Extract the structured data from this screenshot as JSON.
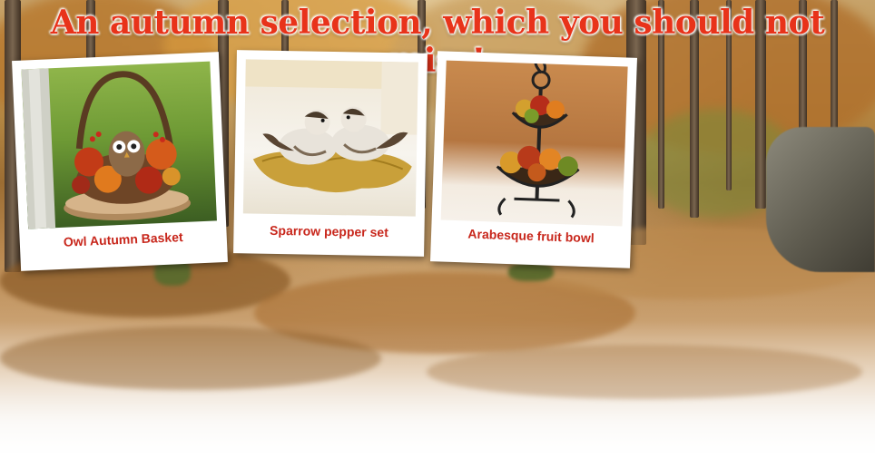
{
  "banner": {
    "headline": "An autumn selection, which you should not miss!"
  },
  "products": [
    {
      "title": "Owl Autumn Basket"
    },
    {
      "title": "Sparrow pepper set"
    },
    {
      "title": "Arabesque fruit bowl"
    }
  ],
  "colors": {
    "headline": "#e8331a",
    "caption": "#c8271c",
    "card_background": "#ffffff"
  },
  "icons": [
    "owl-basket-image",
    "sparrow-salt-pepper-image",
    "fruit-bowl-image"
  ]
}
